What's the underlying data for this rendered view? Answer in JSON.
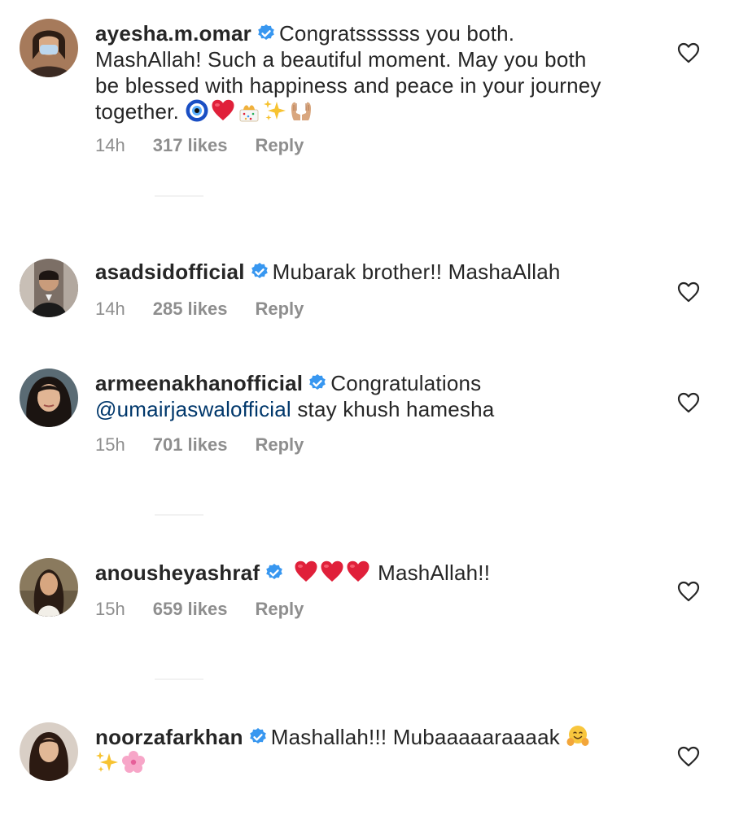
{
  "comments": [
    {
      "username": "ayesha.m.omar",
      "text_lines": [
        "Congratssssss you both.",
        "MashAllah! Such a beautiful moment. May you both",
        "be blessed with happiness and peace in your journey",
        "together."
      ],
      "emojis": [
        "nazar-amulet",
        "red-heart",
        "confetti",
        "sparkles",
        "palms-up"
      ],
      "time": "14h",
      "likes": "317 likes",
      "reply": "Reply"
    },
    {
      "username": "asadsidofficial",
      "text": "Mubarak brother!! MashaAllah",
      "time": "14h",
      "likes": "285 likes",
      "reply": "Reply"
    },
    {
      "username": "armeenakhanofficial",
      "text": "Congratulations",
      "mention": "@umairjaswalofficial",
      "text_after": "stay khush hamesha",
      "time": "15h",
      "likes": "701 likes",
      "reply": "Reply"
    },
    {
      "username": "anousheyashraf",
      "emojis": [
        "red-heart",
        "red-heart",
        "red-heart"
      ],
      "text": "MashAllah!!",
      "time": "15h",
      "likes": "659 likes",
      "reply": "Reply"
    },
    {
      "username": "noorzafarkhan",
      "text": "Mashallah!!! Mubaaaaaraaaak",
      "emojis": [
        "hugging-face",
        "sparkles",
        "cherry-blossom"
      ]
    }
  ],
  "colors": {
    "verified": "#3897f0",
    "mention": "#00376b",
    "meta": "#8e8e8e"
  }
}
